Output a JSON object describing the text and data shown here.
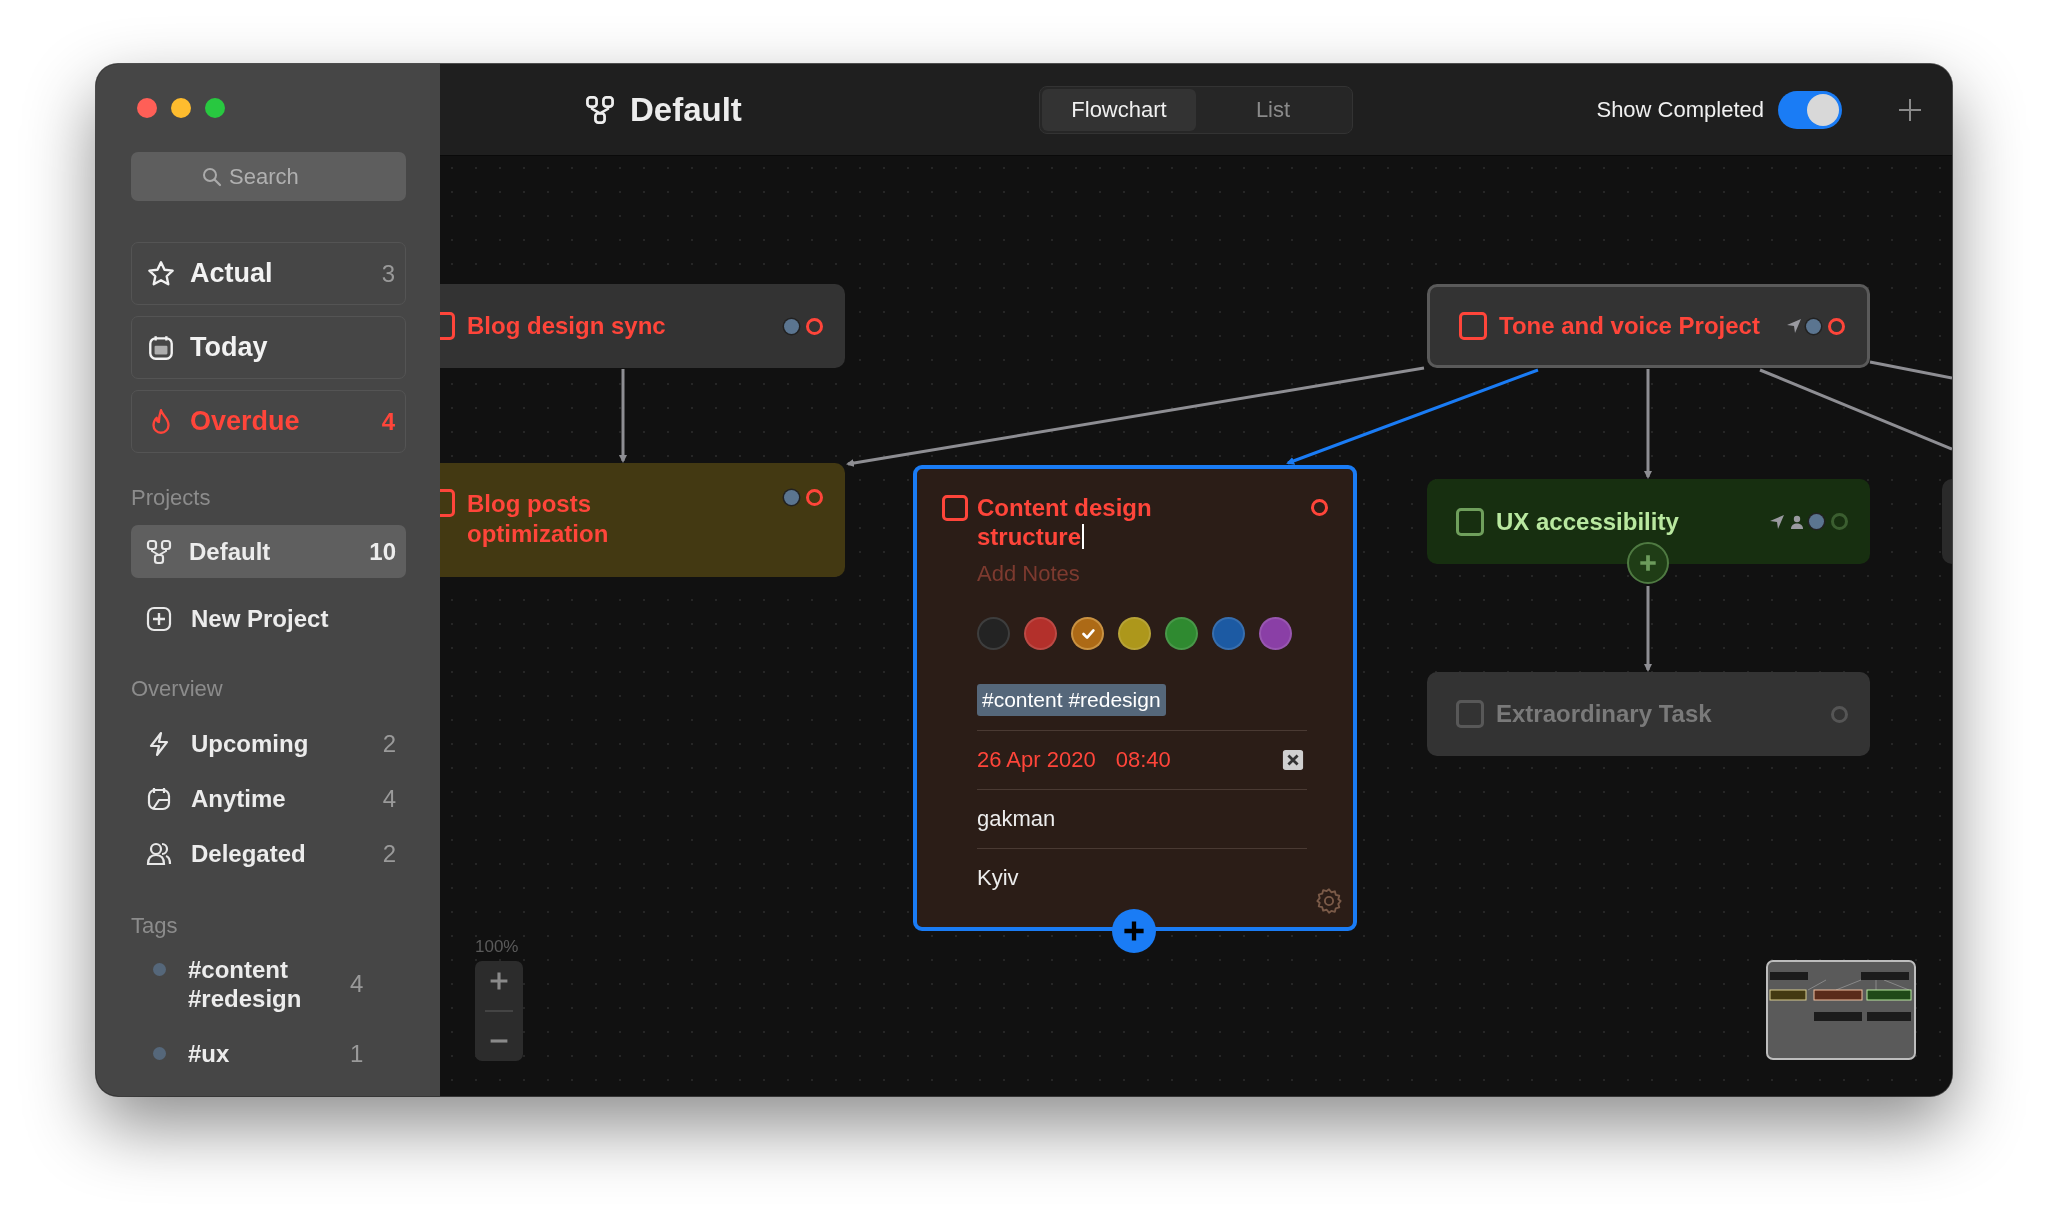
{
  "sidebar": {
    "search": {
      "placeholder": "Search"
    },
    "smart_lists": [
      {
        "kind": "actual",
        "label": "Actual",
        "count": "3",
        "alert": false
      },
      {
        "kind": "today",
        "label": "Today",
        "alert": false
      },
      {
        "kind": "overdue",
        "label": "Overdue",
        "count": "4",
        "alert": true
      }
    ],
    "projects_heading": "Projects",
    "projects": [
      {
        "label": "Default",
        "count": "10",
        "selected": true
      }
    ],
    "new_project": "New Project",
    "overview_heading": "Overview",
    "overview": [
      {
        "kind": "upcoming",
        "label": "Upcoming",
        "count": "2"
      },
      {
        "kind": "anytime",
        "label": "Anytime",
        "count": "4"
      },
      {
        "kind": "delegated",
        "label": "Delegated",
        "count": "2"
      }
    ],
    "tags_heading": "Tags",
    "tags": [
      {
        "label": "#content #redesign",
        "count": "4",
        "color": "#55677a"
      },
      {
        "label": "#ux",
        "count": "1",
        "color": "#55677a"
      }
    ]
  },
  "header": {
    "title": "Default",
    "view_tabs": [
      {
        "label": "Flowchart",
        "selected": true
      },
      {
        "label": "List",
        "selected": false
      }
    ],
    "show_completed": {
      "label": "Show Completed",
      "on": true
    }
  },
  "canvas": {
    "zoom_label": "100%",
    "tasks": [
      {
        "title": "Blog design sync",
        "checked": false,
        "overdue": true,
        "disabled": false,
        "color": "#333333",
        "location": false,
        "delegated": false,
        "tagged": true
      },
      {
        "title": "Blog posts optimization",
        "checked": false,
        "overdue": true,
        "disabled": false,
        "color": "#433912",
        "location": false,
        "delegated": false,
        "tagged": true
      },
      {
        "title": "Tone and voice Project",
        "checked": false,
        "overdue": true,
        "disabled": false,
        "color": "#333333",
        "location": true,
        "delegated": false,
        "tagged": true
      },
      {
        "title": "UX accessibility",
        "checked": false,
        "overdue": false,
        "disabled": false,
        "color": "#172f10",
        "location": true,
        "delegated": true,
        "tagged": true
      },
      {
        "title": "Extraordinary Task",
        "checked": false,
        "overdue": false,
        "disabled": true,
        "color": "#333333",
        "location": false,
        "delegated": false,
        "tagged": false
      }
    ],
    "selected_task": {
      "title": "Content design structure",
      "checked": false,
      "overdue": true,
      "notes_placeholder": "Add Notes",
      "colors": [
        {
          "color": "#232323",
          "selected": false
        },
        {
          "color": "#b3302b",
          "selected": false
        },
        {
          "color": "#ad6a16",
          "selected": true
        },
        {
          "color": "#ad971b",
          "selected": false
        },
        {
          "color": "#2f8a30",
          "selected": false
        },
        {
          "color": "#1c5aa3",
          "selected": false
        },
        {
          "color": "#8a3fa6",
          "selected": false
        }
      ],
      "tag": "#content #redesign",
      "date": "26 Apr 2020",
      "time": "08:40",
      "assignee": "gakman",
      "location": "Kyiv"
    }
  }
}
